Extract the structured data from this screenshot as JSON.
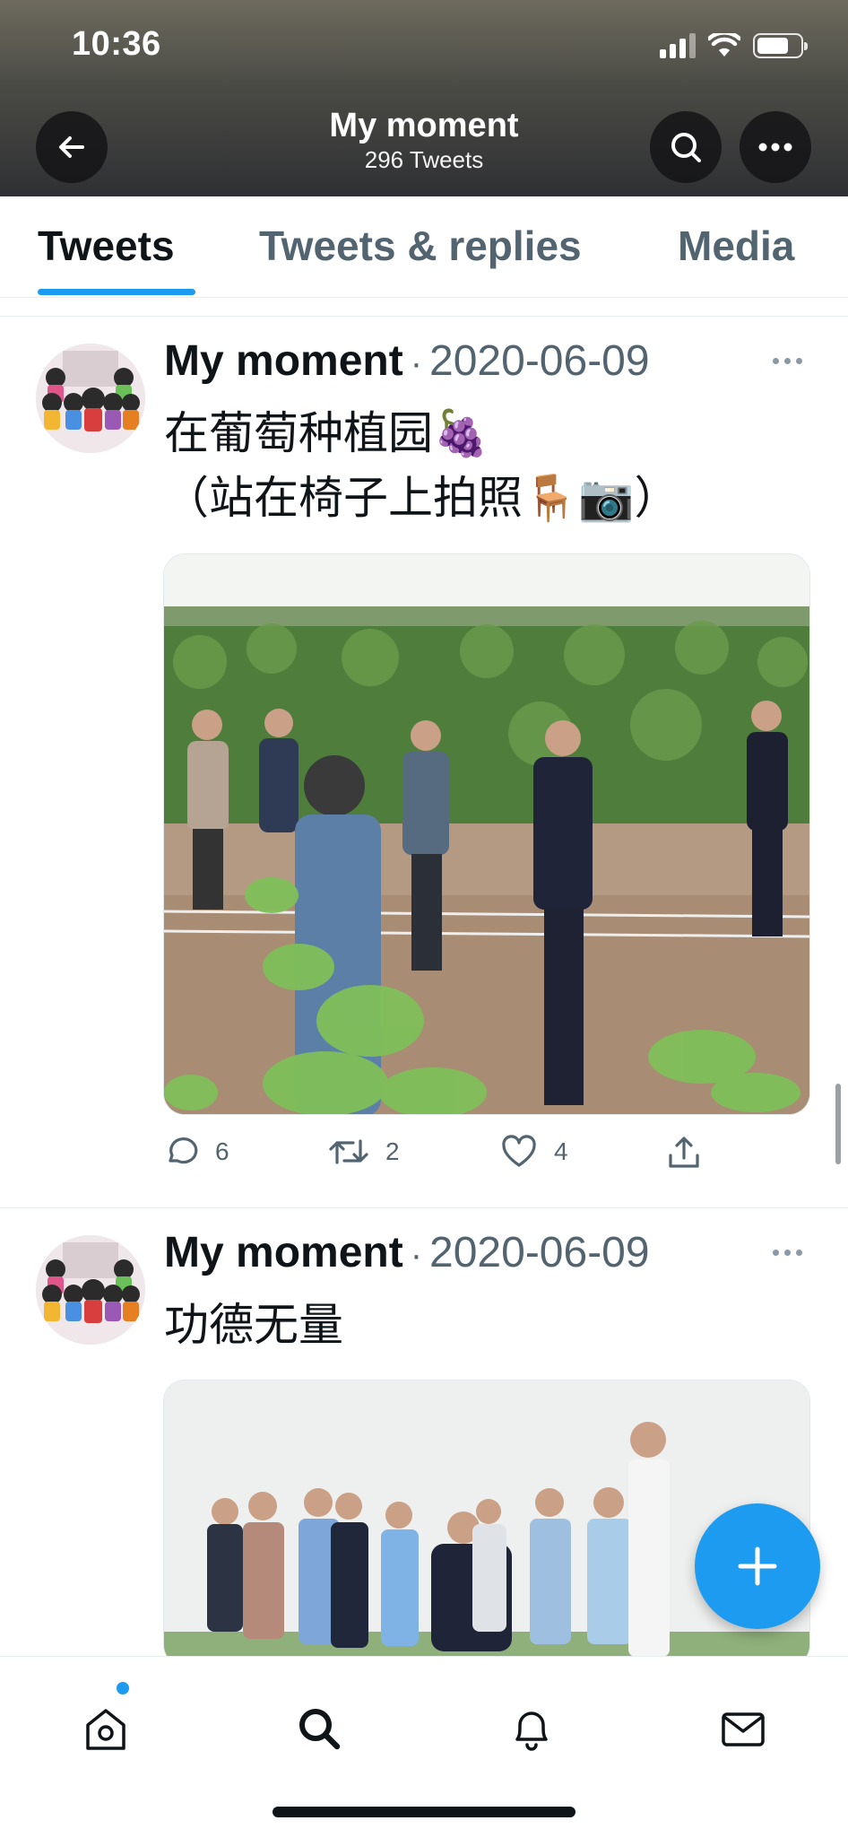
{
  "status_bar": {
    "time": "10:36"
  },
  "header": {
    "title": "My moment",
    "subtitle": "296 Tweets",
    "back_icon": "arrow-left-icon",
    "search_icon": "search-icon",
    "more_icon": "more-horizontal-icon"
  },
  "tabs": [
    {
      "label": "Tweets",
      "active": true
    },
    {
      "label": "Tweets & replies",
      "active": false
    },
    {
      "label": "Media",
      "active": false
    }
  ],
  "tweets": [
    {
      "name": "My moment",
      "separator": "·",
      "date": "2020-06-09",
      "text_line1": "在葡萄种植园🍇",
      "text_line2": "（站在椅子上拍照🪑📷）",
      "replies": "6",
      "retweets": "2",
      "likes": "4"
    },
    {
      "name": "My moment",
      "separator": "·",
      "date": "2020-06-09",
      "text_line1": "功德无量"
    }
  ],
  "colors": {
    "accent": "#1d9bf0",
    "secondary_text": "#536471",
    "primary_text": "#0f1419"
  },
  "tabbar": {
    "items": [
      "home-icon",
      "search-icon",
      "notifications-bell-icon",
      "messages-mail-icon"
    ],
    "home_has_badge": true
  },
  "fab_icon": "compose-plus-icon"
}
